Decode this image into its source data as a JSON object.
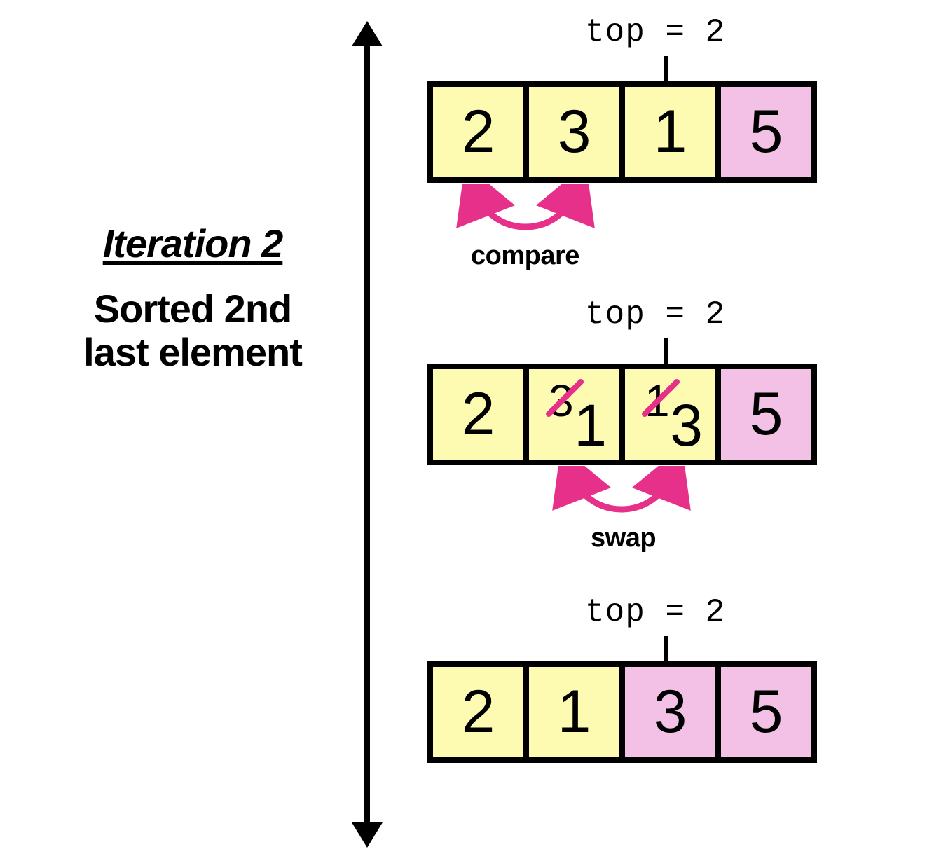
{
  "iteration_title": "Iteration 2",
  "iteration_subtitle_line1": "Sorted 2nd",
  "iteration_subtitle_line2": "last element",
  "top_label": "top = 2",
  "op_compare": "compare",
  "op_swap": "swap",
  "colors": {
    "unsorted": "#fdfab1",
    "sorted": "#f3c1e5",
    "accent": "#e6308a",
    "stroke": "#000000"
  },
  "rows": [
    {
      "top_label": true,
      "values": [
        "2",
        "3",
        "1",
        "5"
      ],
      "sorted_from_index": 3,
      "arc": {
        "from": 0,
        "to": 1,
        "label": "compare"
      },
      "swap": null
    },
    {
      "top_label": true,
      "values": [
        "2",
        "3",
        "1",
        "5"
      ],
      "sorted_from_index": 3,
      "arc": {
        "from": 1,
        "to": 2,
        "label": "swap"
      },
      "swap": {
        "indices": [
          1,
          2
        ],
        "old": [
          "3",
          "1"
        ],
        "new": [
          "1",
          "3"
        ]
      }
    },
    {
      "top_label": true,
      "values": [
        "2",
        "1",
        "3",
        "5"
      ],
      "sorted_from_index": 2,
      "arc": null,
      "swap": null
    }
  ]
}
